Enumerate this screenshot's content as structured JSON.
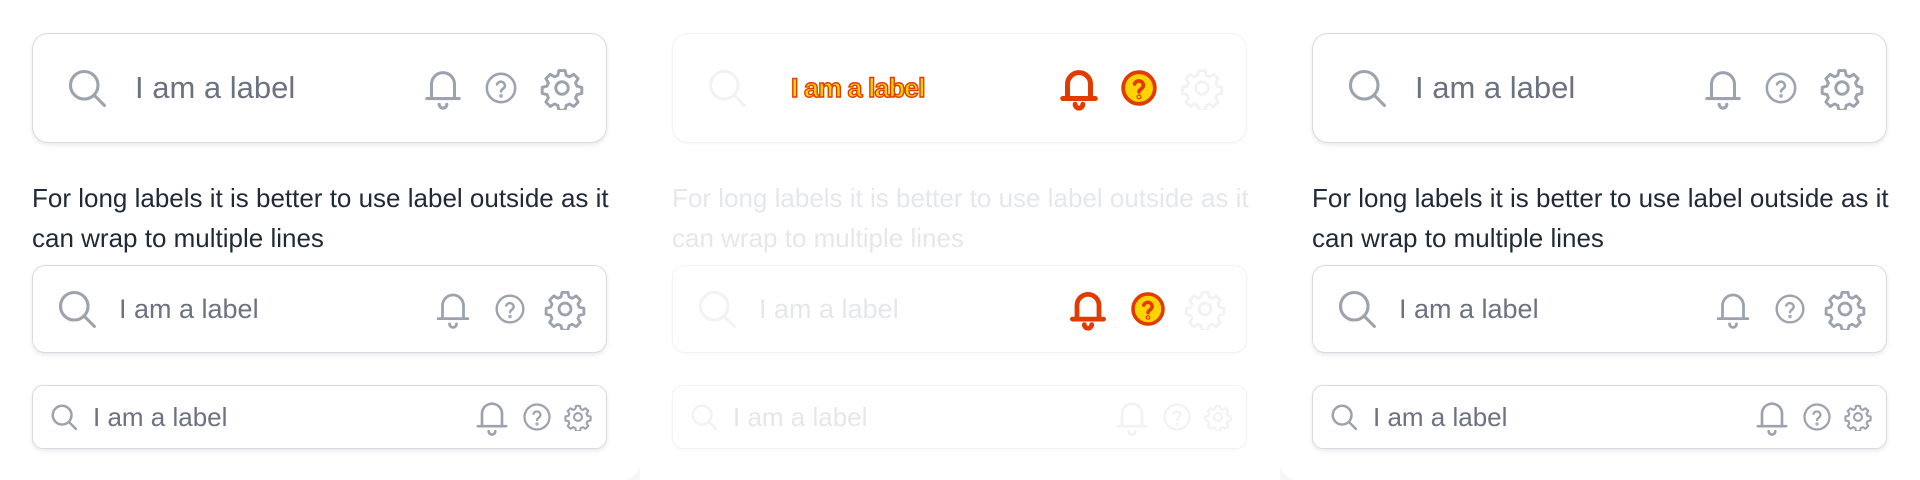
{
  "panels": [
    {
      "fields": [
        {
          "size": "large",
          "label": "I am a label",
          "icons": [
            "search-icon",
            "bell-icon",
            "help-circle-icon",
            "gear-icon"
          ]
        }
      ],
      "hint": "For long labels it is better to use label outside as it can wrap to multiple lines",
      "outside_fields": [
        {
          "size": "medium",
          "label": "I am a label",
          "icons": [
            "search-icon",
            "bell-icon",
            "help-circle-icon",
            "gear-icon"
          ]
        },
        {
          "size": "small",
          "label": "I am a label",
          "icons": [
            "search-icon",
            "bell-icon",
            "help-circle-icon",
            "gear-icon"
          ]
        }
      ]
    },
    {
      "fields": [
        {
          "size": "large",
          "label": "I am a label",
          "icons": [
            "search-icon",
            "bell-icon",
            "help-circle-icon",
            "gear-icon"
          ]
        }
      ],
      "hint": "For long labels it is better to use label outside as it can wrap to multiple lines",
      "outside_fields": [
        {
          "size": "medium",
          "label": "I am a label",
          "icons": [
            "search-icon",
            "bell-icon",
            "help-circle-icon",
            "gear-icon"
          ]
        },
        {
          "size": "small",
          "label": "I am a label",
          "icons": [
            "search-icon",
            "bell-icon",
            "help-circle-icon",
            "gear-icon"
          ]
        }
      ]
    },
    {
      "fields": [
        {
          "size": "large",
          "label": "I am a label",
          "icons": [
            "search-icon",
            "bell-icon",
            "help-circle-icon",
            "gear-icon"
          ]
        }
      ],
      "hint": "For long labels it is better to use label outside as it can wrap to multiple lines",
      "outside_fields": [
        {
          "size": "medium",
          "label": "I am a label",
          "icons": [
            "search-icon",
            "bell-icon",
            "help-circle-icon",
            "gear-icon"
          ]
        },
        {
          "size": "small",
          "label": "I am a label",
          "icons": [
            "search-icon",
            "bell-icon",
            "help-circle-icon",
            "gear-icon"
          ]
        }
      ]
    }
  ],
  "colors": {
    "icon": "#9ca3af",
    "label": "#6b7280",
    "hint_text": "#1f2937",
    "border": "#d8dbe2",
    "diff_fill": "#ffd400",
    "diff_stroke": "#e23a00"
  }
}
